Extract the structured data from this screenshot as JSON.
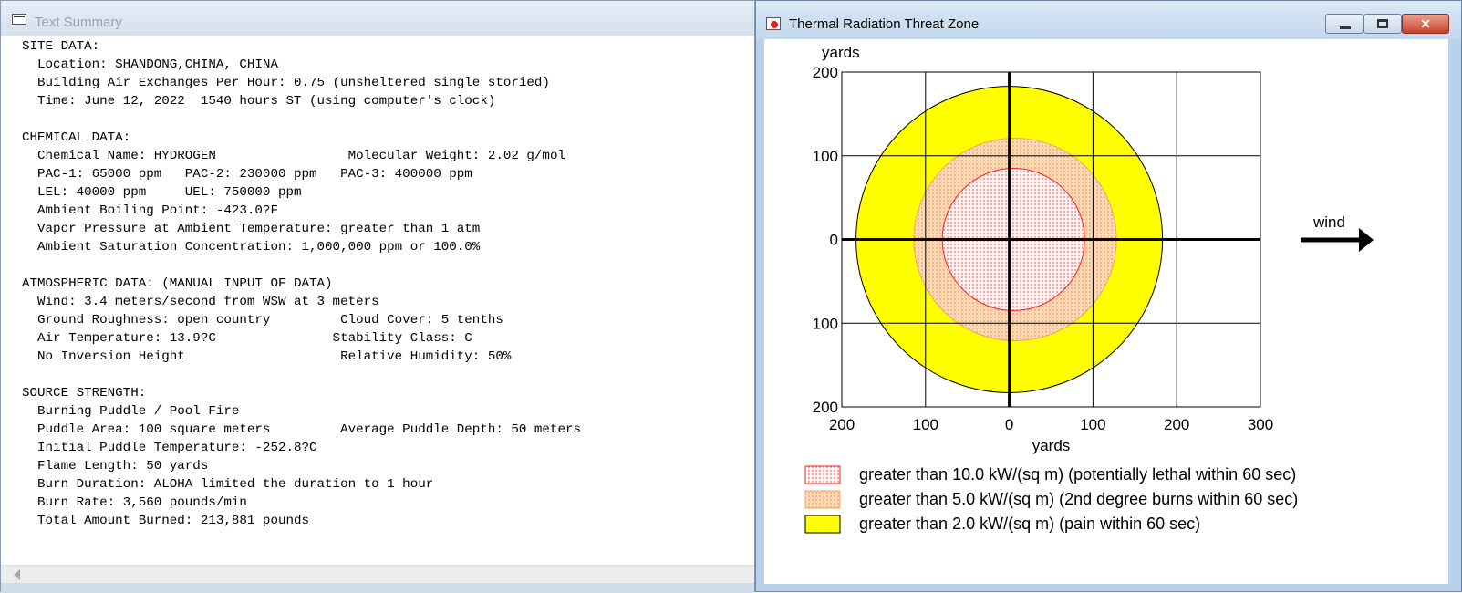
{
  "summary_window": {
    "title": "Text Summary",
    "text": "SITE DATA:\n  Location: SHANDONG,CHINA, CHINA\n  Building Air Exchanges Per Hour: 0.75 (unsheltered single storied)\n  Time: June 12, 2022  1540 hours ST (using computer's clock)\n\nCHEMICAL DATA:\n  Chemical Name: HYDROGEN                 Molecular Weight: 2.02 g/mol\n  PAC-1: 65000 ppm   PAC-2: 230000 ppm   PAC-3: 400000 ppm\n  LEL: 40000 ppm     UEL: 750000 ppm\n  Ambient Boiling Point: -423.0?F\n  Vapor Pressure at Ambient Temperature: greater than 1 atm\n  Ambient Saturation Concentration: 1,000,000 ppm or 100.0%\n\nATMOSPHERIC DATA: (MANUAL INPUT OF DATA)\n  Wind: 3.4 meters/second from WSW at 3 meters\n  Ground Roughness: open country         Cloud Cover: 5 tenths\n  Air Temperature: 13.9?C               Stability Class: C\n  No Inversion Height                    Relative Humidity: 50%\n\nSOURCE STRENGTH:\n  Burning Puddle / Pool Fire\n  Puddle Area: 100 square meters         Average Puddle Depth: 50 meters\n  Initial Puddle Temperature: -252.8?C\n  Flame Length: 50 yards\n  Burn Duration: ALOHA limited the duration to 1 hour\n  Burn Rate: 3,560 pounds/min\n  Total Amount Burned: 213,881 pounds"
  },
  "plot_window": {
    "title": "Thermal Radiation Threat Zone",
    "buttons": {
      "minimize_icon": "minimize-icon",
      "maximize_icon": "maximize-icon",
      "close_icon": "close-icon"
    },
    "wind_label": "wind",
    "colors": {
      "red_zone": "#ff2020",
      "orange_zone": "#fdd9b5",
      "yellow_zone": "#ffff00"
    }
  },
  "chart_data": {
    "type": "threat-zone",
    "xlabel": "yards",
    "ylabel": "yards",
    "xlim": [
      -200,
      300
    ],
    "ylim": [
      -200,
      200
    ],
    "x_ticks": [
      {
        "value": -200,
        "label": "200"
      },
      {
        "value": -100,
        "label": "100"
      },
      {
        "value": 0,
        "label": "0"
      },
      {
        "value": 100,
        "label": "100"
      },
      {
        "value": 200,
        "label": "200"
      },
      {
        "value": 300,
        "label": "300"
      }
    ],
    "y_ticks": [
      {
        "value": 200,
        "label": "200"
      },
      {
        "value": 100,
        "label": "100"
      },
      {
        "value": 0,
        "label": "0"
      },
      {
        "value": -100,
        "label": "100"
      },
      {
        "value": -200,
        "label": "200"
      }
    ],
    "grid": true,
    "zones": [
      {
        "name": "yellow",
        "center": [
          0,
          0
        ],
        "radius": 183,
        "fill": "#ffff00",
        "stroke": "#000000",
        "pattern": "solid",
        "legend": "greater than 2.0 kW/(sq m) (pain within 60 sec)"
      },
      {
        "name": "orange",
        "center": [
          7,
          0
        ],
        "radius": 121,
        "fill": "#fdd9b5",
        "stroke": "#f4a460",
        "pattern": "dots",
        "legend": "greater than 5.0 kW/(sq m) (2nd degree burns within 60 sec)"
      },
      {
        "name": "red",
        "center": [
          5,
          0
        ],
        "radius": 85,
        "fill": "#fff4f4",
        "stroke": "#ff2020",
        "pattern": "dots",
        "legend": "greater than 10.0 kW/(sq m) (potentially lethal within 60 sec)"
      }
    ],
    "legend_order": [
      "red",
      "orange",
      "yellow"
    ]
  }
}
